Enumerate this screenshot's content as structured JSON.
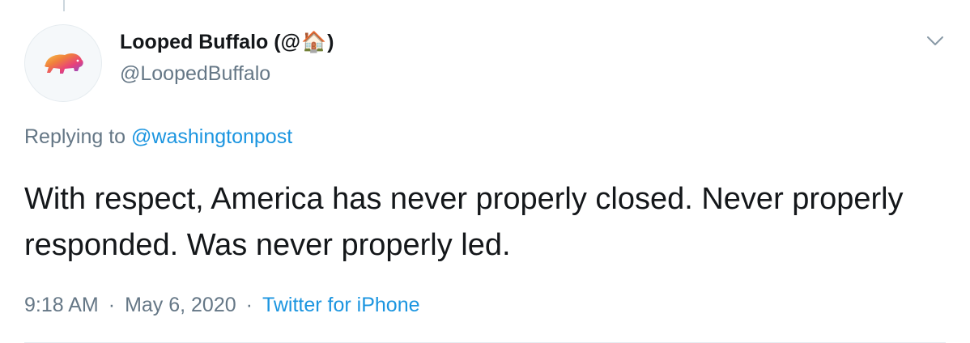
{
  "user": {
    "display_name": "Looped Buffalo (@",
    "display_name_end": ")",
    "emoji": "🏠",
    "handle": "@LoopedBuffalo"
  },
  "reply": {
    "prefix": "Replying to",
    "target": "@washingtonpost"
  },
  "tweet": {
    "text": "With respect, America has never properly closed. Never properly responded. Was never properly led."
  },
  "meta": {
    "time": "9:18 AM",
    "separator": "·",
    "date": "May 6, 2020",
    "source": "Twitter for iPhone"
  },
  "icons": {
    "avatar": "buffalo-logo",
    "menu": "chevron-down-icon"
  },
  "colors": {
    "link": "#1b95e0",
    "secondary_text": "#657786",
    "primary_text": "#14171a"
  }
}
